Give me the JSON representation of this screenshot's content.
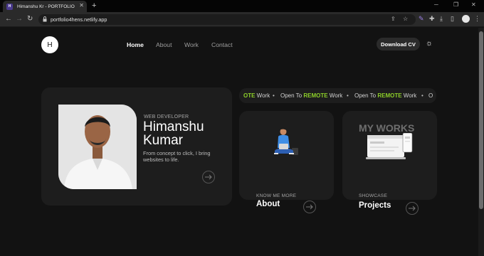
{
  "browser": {
    "tab_title": "Himanshu Kr - PORTFOLIO",
    "tab_favicon_text": "H",
    "url": "portfolio4hens.netlify.app"
  },
  "nav": {
    "logo_letter": "H",
    "items": [
      "Home",
      "About",
      "Work",
      "Contact"
    ],
    "active": "Home",
    "download_cv": "Download CV"
  },
  "hero": {
    "role": "WEB DEVELOPER",
    "name": "Himanshu Kumar",
    "tagline": "From concept to click, I bring websites to life."
  },
  "marquee": {
    "items": [
      {
        "highlight": "OTE",
        "rest": " Work"
      },
      {
        "highlight": "",
        "rest": "Open To "
      },
      {
        "highlight": "REMOTE",
        "rest": " Work"
      },
      {
        "highlight": "",
        "rest": "Open To "
      },
      {
        "highlight": "REMOTE",
        "rest": " Work"
      },
      {
        "highlight": "",
        "rest": "O"
      }
    ],
    "highlight_color": "#8ccf29"
  },
  "about_card": {
    "kicker": "KNOW ME MORE",
    "title": "About"
  },
  "works_card": {
    "heading": "MY WORKS",
    "kicker": "SHOWCASE",
    "title": "Projects"
  },
  "colors": {
    "page_bg": "#121212",
    "card_bg": "#1d1d1d",
    "accent_green": "#8ccf29"
  }
}
